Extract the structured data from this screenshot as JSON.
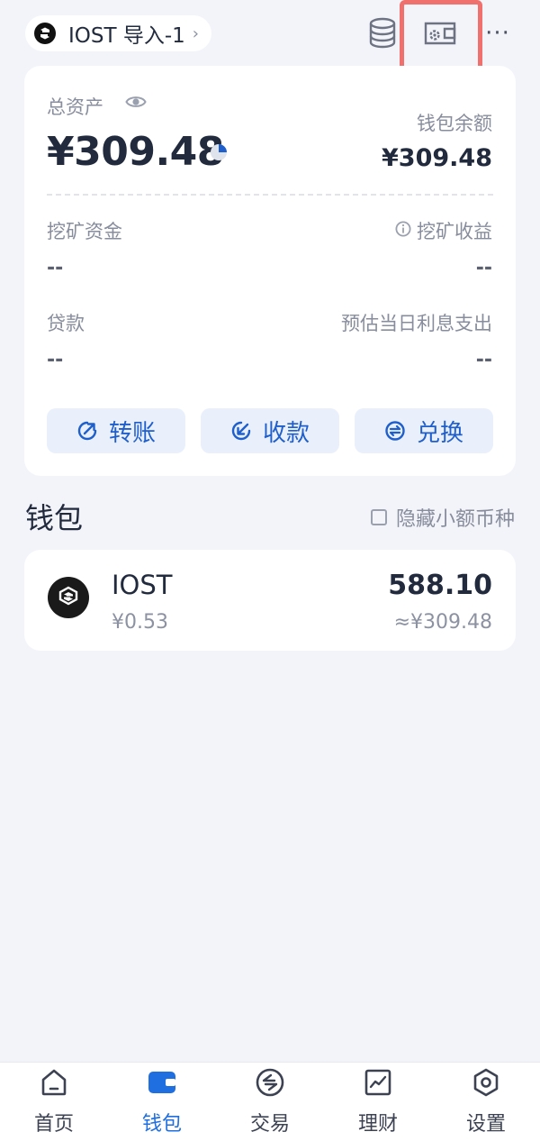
{
  "header": {
    "wallet_name": "IOST 导入-1",
    "chevron": "›",
    "icons": [
      "coins-stack-icon",
      "card-settings-icon",
      "more-icon"
    ],
    "more_glyph": "···"
  },
  "assets": {
    "total_label": "总资产",
    "total_value": "¥309.48",
    "balance_label": "钱包余额",
    "balance_value": "¥309.48",
    "mining_funds_label": "挖矿资金",
    "mining_funds_value": "--",
    "mining_income_label": "挖矿收益",
    "mining_income_value": "--",
    "loan_label": "贷款",
    "loan_value": "--",
    "interest_label": "预估当日利息支出",
    "interest_value": "--"
  },
  "actions": {
    "transfer": "转账",
    "receive": "收款",
    "swap": "兑换"
  },
  "wallet_section": {
    "title": "钱包",
    "hide_small_label": "隐藏小额币种",
    "hide_small_checked": false
  },
  "tokens": [
    {
      "symbol": "IOST",
      "price": "¥0.53",
      "amount": "588.10",
      "fiat": "≈¥309.48"
    }
  ],
  "bottom_nav": {
    "items": [
      {
        "label": "首页",
        "icon": "home-icon"
      },
      {
        "label": "钱包",
        "icon": "wallet-icon"
      },
      {
        "label": "交易",
        "icon": "trade-icon"
      },
      {
        "label": "理财",
        "icon": "finance-chart-icon"
      },
      {
        "label": "设置",
        "icon": "settings-icon"
      }
    ],
    "active": "钱包"
  },
  "colors": {
    "accent": "#1f6fe0",
    "button_bg": "#e9f0fb",
    "highlight": "#f0706e",
    "background": "#f3f4f9"
  }
}
